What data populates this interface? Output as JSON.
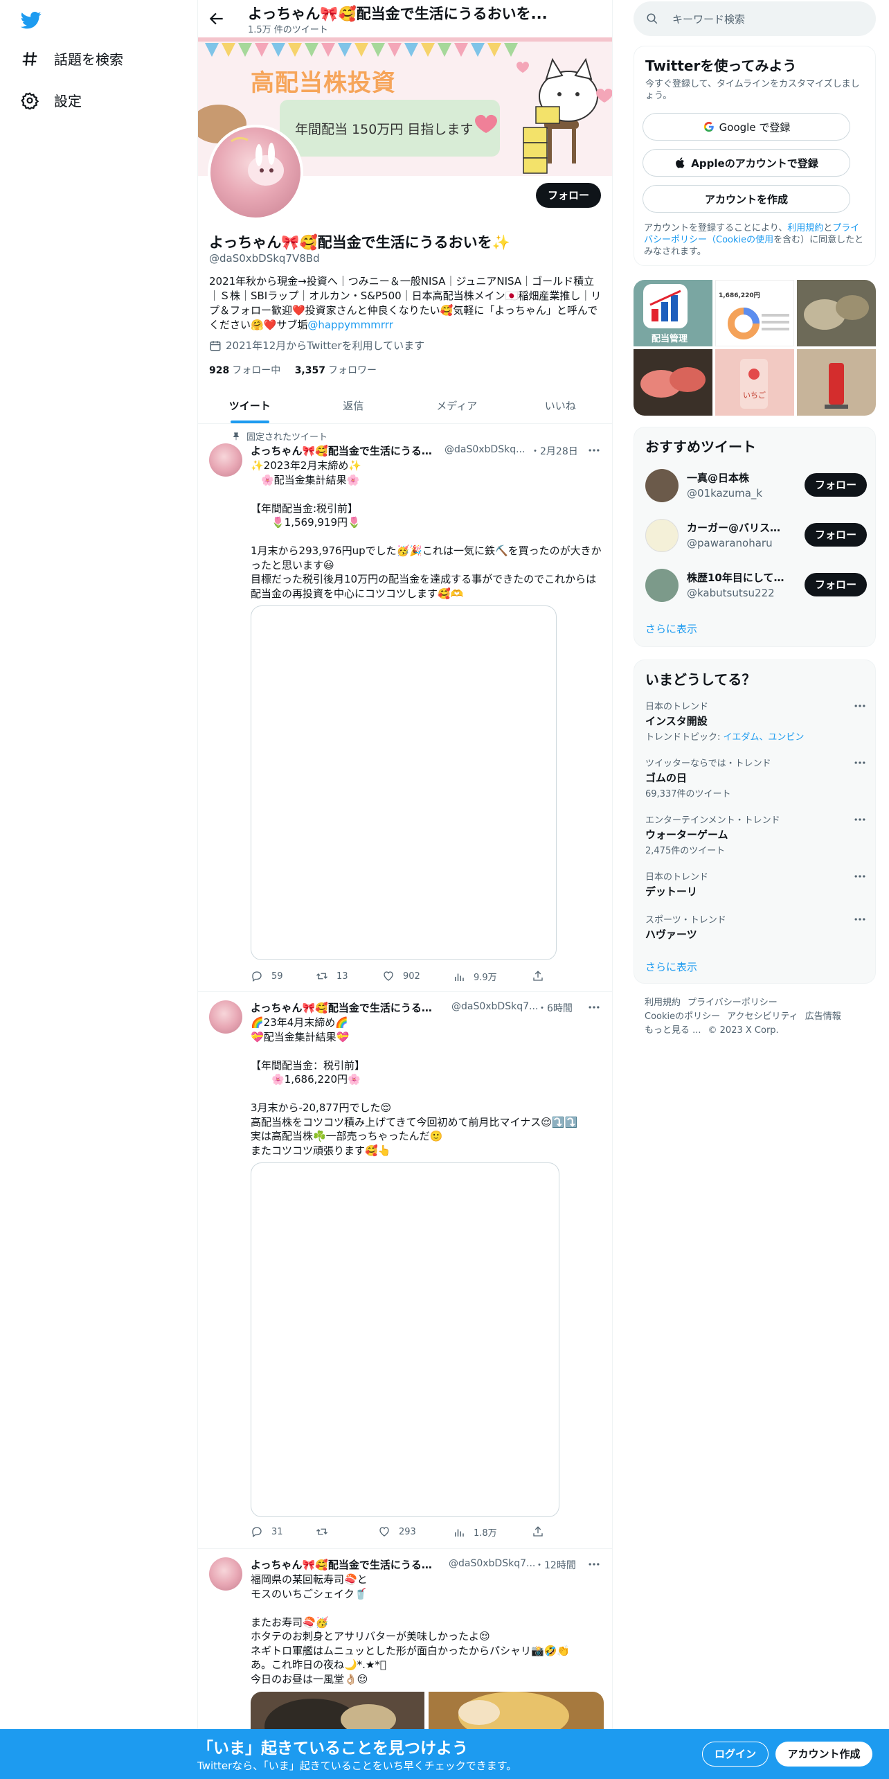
{
  "nav": {
    "explore_label": "話題を検索",
    "settings_label": "設定"
  },
  "header": {
    "title": "よっちゃん🎀🥰配当金で生活にうるおいを...",
    "tweet_count": "1.5万 件のツイート"
  },
  "banner": {
    "headline": "高配当株投資",
    "goal": "年間配当 150万円 目指します"
  },
  "profile": {
    "follow_label": "フォロー",
    "name": "よっちゃん🎀🥰配当金で生活にうるおいを✨",
    "handle": "@daS0xbDSkq7V8Bd",
    "bio": "2021年秋から現金→投資へ｜つみニー＆一般NISA｜ジュニアNISA｜ゴールド積立｜Ｓ株｜SBIラップ｜オルカン・S&P500｜日本高配当株メイン🇯🇵稲畑産業推し｜リプ＆フォロー歓迎❤️投資家さんと仲良くなりたい🥰気軽に「よっちゃん」と呼んでください🤗❤️サブ垢",
    "bio_link": "@happymmmrrr",
    "joined": "2021年12月からTwitterを利用しています",
    "following_count": "928",
    "following_label": "フォロー中",
    "followers_count": "3,357",
    "followers_label": "フォロワー"
  },
  "tabs": [
    "ツイート",
    "返信",
    "メディア",
    "いいね"
  ],
  "tweets": [
    {
      "pinned_label": "固定されたツイート",
      "name": "よっちゃん🎀🥰配当金で生活にうるお...",
      "handle": "@daS0xbDSkq...",
      "time": "・2月28日",
      "text": "✨2023年2月末締め✨\n　🌸配当金集計結果🌸\n\n【年間配当金:税引前】\n　　🌷1,569,919円🌷\n\n1月末から293,976円upでした🥳🎉これは一気に鉄⛏️を買ったのが大きかったと思います😃\n目標だった税引後月10万円の配当金を達成する事ができたのでこれからは配当金の再投資を中心にコツコツします🥰🫶",
      "replies": "59",
      "retweets": "13",
      "likes": "902",
      "views": "9.9万"
    },
    {
      "name": "よっちゃん🎀🥰配当金で生活にうるお...",
      "handle": "@daS0xbDSkq7...",
      "time": "・6時間",
      "text": "🌈23年4月末締め🌈\n💝配当金集計結果💝\n\n【年間配当金：税引前】\n　　🌸1,686,220円🌸\n\n3月末から-20,877円でした😌\n高配当株をコツコツ積み上げてきて今回初めて前月比マイナス😌⤵️⤵️\n実は高配当株☘️一部売っちゃったんだ🙂\nまたコツコツ頑張ります🥰👆",
      "replies": "31",
      "retweets": "",
      "likes": "293",
      "views": "1.8万"
    },
    {
      "name": "よっちゃん🎀🥰配当金で生活にうるお...",
      "handle": "@daS0xbDSkq7...",
      "time": "・12時間",
      "text": "福岡県の某回転寿司🍣と\nモスのいちごシェイク🥤\n\nまたお寿司🍣🥳\nホタテのお刺身とアサリバターが美味しかったよ😌\nネギトロ軍艦はムニュッとした形が面白かったからパシャリ📸🤣👏\nあ。これ昨日の夜ね🌙*.★*ﾟ\n今日のお昼は一風堂👌🏼😌"
    }
  ],
  "right": {
    "search_placeholder": "キーワード検索",
    "signup_card": {
      "title": "Twitterを使ってみよう",
      "subtitle": "今すぐ登録して、タイムラインをカスタマイズしましょう。",
      "google_label": "Google で登録",
      "apple_label": "Appleのアカウントで登録",
      "create_label": "アカウントを作成",
      "legal_prefix": "アカウントを登録することにより、",
      "legal_terms": "利用規約",
      "legal_and": "と",
      "legal_privacy": "プライバシーポリシー",
      "legal_cookie": "（Cookieの使用",
      "legal_suffix": "を含む）に同意したとみなされます。"
    },
    "thumbs": {
      "thumb1_caption": "配当管理",
      "thumb2_amount": "1,686,220円",
      "thumb5_text": "いちご"
    },
    "recommended": {
      "title": "おすすめツイート",
      "users": [
        {
          "name": "一真@日本株",
          "handle": "@01kazuma_k",
          "follow": "フォロー"
        },
        {
          "name": "カーガー@バリスタ...",
          "handle": "@pawaranoharu",
          "follow": "フォロー"
        },
        {
          "name": "株歴10年目にして配...",
          "handle": "@kabutsutsu222",
          "follow": "フォロー"
        }
      ],
      "more": "さらに表示"
    },
    "trends": {
      "title": "いまどうしてる？",
      "items": [
        {
          "context": "日本のトレンド",
          "name": "インスタ開設",
          "extra_prefix": "トレンドトピック: ",
          "extra_links": "イエダム、ユンビン"
        },
        {
          "context": "ツイッターならでは・トレンド",
          "name": "ゴムの日",
          "extra": "69,337件のツイート"
        },
        {
          "context": "エンターテインメント・トレンド",
          "name": "ウォーターゲーム",
          "extra": "2,475件のツイート"
        },
        {
          "context": "日本のトレンド",
          "name": "デットーリ"
        },
        {
          "context": "スポーツ・トレンド",
          "name": "ハヴァーツ"
        }
      ],
      "more": "さらに表示"
    },
    "footer": {
      "terms": "利用規約",
      "privacy": "プライバシーポリシー",
      "cookie": "Cookieのポリシー",
      "accessibility": "アクセシビリティ",
      "ads": "広告情報",
      "more": "もっと見る ...",
      "copyright": "© 2023 X Corp."
    }
  },
  "bottom_bar": {
    "title": "「いま」起きていることを見つけよう",
    "subtitle": "Twitterなら、「いま」起きていることをいち早くチェックできます。",
    "login": "ログイン",
    "signup": "アカウント作成"
  },
  "colors": {
    "accent": "#1d9bf0",
    "text": "#0f1419",
    "muted": "#536471",
    "button_dark": "#0f1419"
  }
}
